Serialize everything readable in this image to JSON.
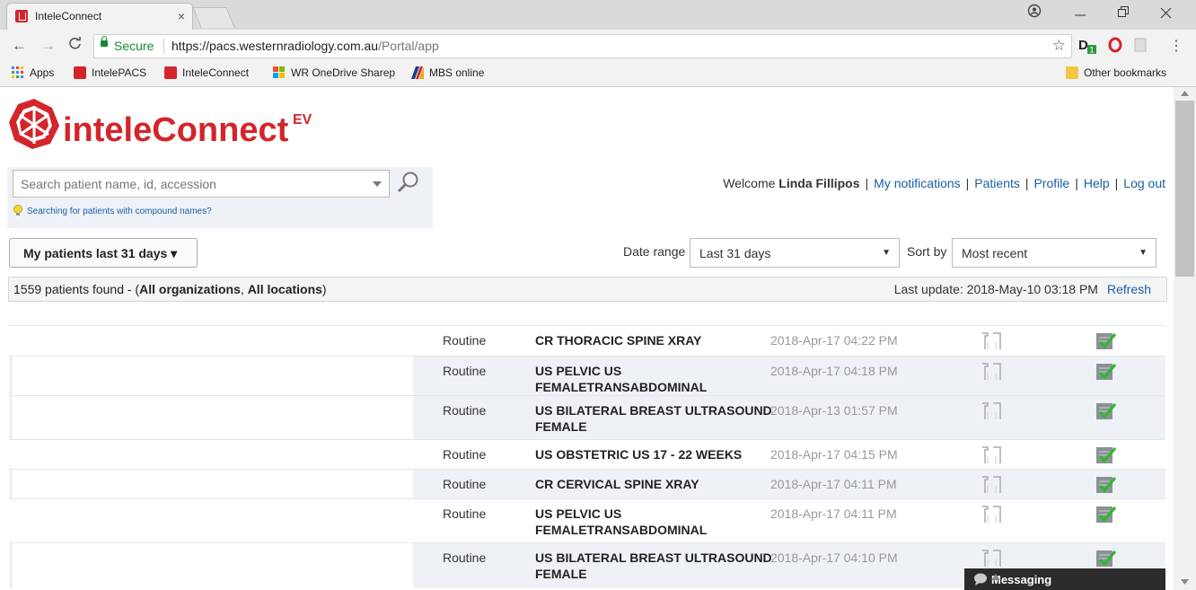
{
  "browser": {
    "tab_title": "InteleConnect",
    "tab_close": "×",
    "url_secure": "Secure",
    "url_base": "https://pacs.westernradiology.com.au",
    "url_path": "/Portal/app",
    "bookmarks": [
      "Apps",
      "IntelePACS",
      "InteleConnect",
      "WR OneDrive Sharep",
      "MBS online"
    ],
    "other_bookmarks": "Other bookmarks",
    "ext_badge": "1"
  },
  "logo": {
    "text": "inteleConnect",
    "suffix": "EV"
  },
  "search": {
    "placeholder": "Search patient name, id, accession",
    "hint": "Searching for patients with compound names?"
  },
  "header_nav": {
    "welcome": "Welcome",
    "user_name": "Linda Fillipos",
    "notifications": "My notifications",
    "patients": "Patients",
    "profile": "Profile",
    "help": "Help",
    "logout": "Log out"
  },
  "filters": {
    "my_patients": "My patients last 31 days ▾",
    "date_range_label": "Date range",
    "date_range_value": "Last 31 days",
    "sort_by_label": "Sort by",
    "sort_by_value": "Most recent"
  },
  "status": {
    "count": "1559 patients found - (",
    "orgs": "All organizations",
    "comma": ", ",
    "locs": "All locations",
    "close": ")",
    "last_update": "Last update: 2018-May-10 03:18 PM",
    "refresh": "Refresh"
  },
  "rows": [
    {
      "priority": "Routine",
      "procedure": "CR THORACIC SPINE XRAY",
      "date": "2018-Apr-17 04:22 PM"
    },
    {
      "priority": "Routine",
      "procedure": "US PELVIC US FEMALETRANSABDOMINAL",
      "date": "2018-Apr-17 04:18 PM"
    },
    {
      "priority": "Routine",
      "procedure": "US BILATERAL BREAST ULTRASOUND FEMALE",
      "date": "2018-Apr-13 01:57 PM"
    },
    {
      "priority": "Routine",
      "procedure": "US OBSTETRIC US 17 - 22 WEEKS",
      "date": "2018-Apr-17 04:15 PM"
    },
    {
      "priority": "Routine",
      "procedure": "CR CERVICAL SPINE XRAY",
      "date": "2018-Apr-17 04:11 PM"
    },
    {
      "priority": "Routine",
      "procedure": "US PELVIC US FEMALETRANSABDOMINAL",
      "date": "2018-Apr-17 04:11 PM"
    },
    {
      "priority": "Routine",
      "procedure": "US BILATERAL BREAST ULTRASOUND FEMALE",
      "date": "2018-Apr-17 04:10 PM"
    }
  ],
  "messaging": {
    "label": "Messaging"
  },
  "colors": {
    "brand_red": "#d3252b",
    "link_blue": "#1a5ea8",
    "alt_row": "#eef2f7"
  }
}
